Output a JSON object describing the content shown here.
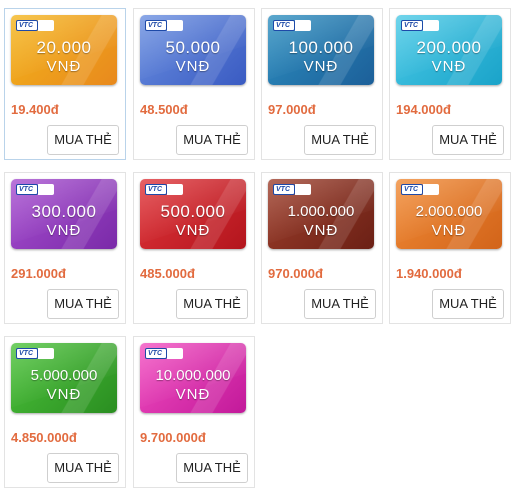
{
  "buy_label": "MUA THẺ",
  "logo_text": "VTC",
  "cards": [
    {
      "amount": "20.000",
      "currency": "VNĐ",
      "price": "19.400đ",
      "color_a": "#f4b51c",
      "color_b": "#e8891d"
    },
    {
      "amount": "50.000",
      "currency": "VNĐ",
      "price": "48.500đ",
      "color_a": "#6a8fe0",
      "color_b": "#3a5bc2"
    },
    {
      "amount": "100.000",
      "currency": "VNĐ",
      "price": "97.000đ",
      "color_a": "#2d8fc0",
      "color_b": "#1c5f99"
    },
    {
      "amount": "200.000",
      "currency": "VNĐ",
      "price": "194.000đ",
      "color_a": "#49c9e6",
      "color_b": "#1aa3c9"
    },
    {
      "amount": "300.000",
      "currency": "VNĐ",
      "price": "291.000đ",
      "color_a": "#a74fd0",
      "color_b": "#7a2aa8"
    },
    {
      "amount": "500.000",
      "currency": "VNĐ",
      "price": "485.000đ",
      "color_a": "#e0353a",
      "color_b": "#b3151d"
    },
    {
      "amount": "1.000.000",
      "currency": "VNĐ",
      "price": "970.000đ",
      "color_a": "#9e3f2c",
      "color_b": "#6b2015"
    },
    {
      "amount": "2.000.000",
      "currency": "VNĐ",
      "price": "1.940.000đ",
      "color_a": "#f08a35",
      "color_b": "#d2641a"
    },
    {
      "amount": "5.000.000",
      "currency": "VNĐ",
      "price": "4.850.000đ",
      "color_a": "#4cc23a",
      "color_b": "#2a8e21"
    },
    {
      "amount": "10.000.000",
      "currency": "VNĐ",
      "price": "9.700.000đ",
      "color_a": "#f24ec0",
      "color_b": "#c2199a"
    }
  ]
}
